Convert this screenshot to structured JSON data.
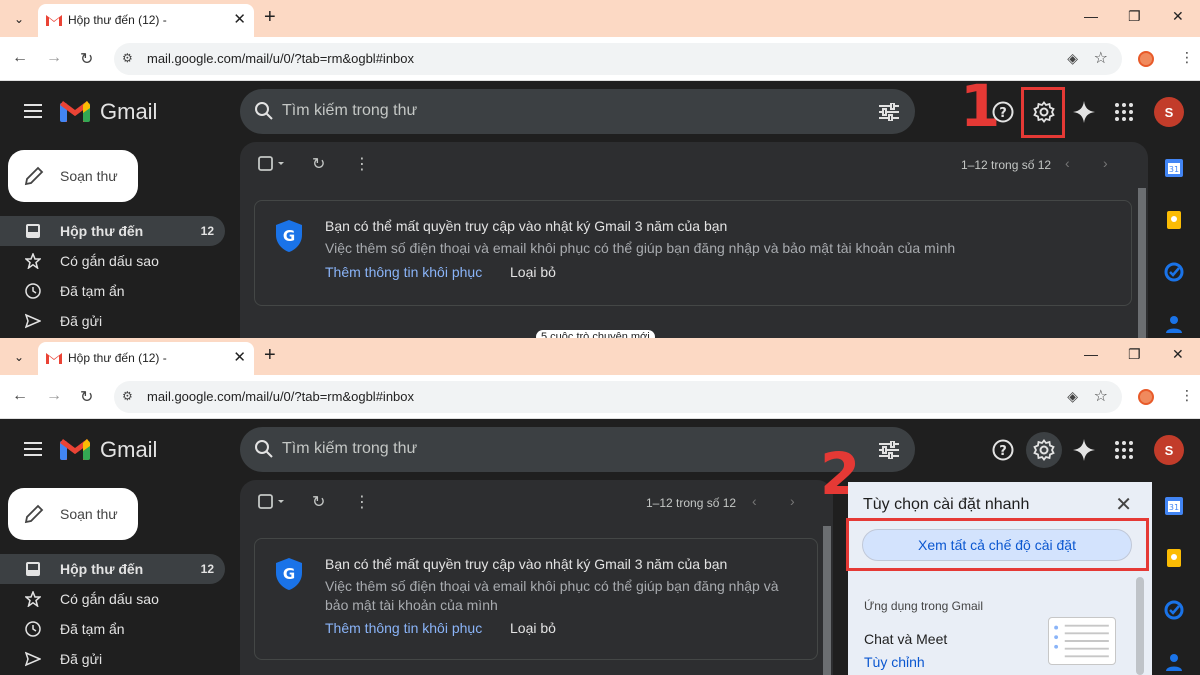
{
  "browser": {
    "tab_title": "Hộp thư đến (12) -",
    "url": "mail.google.com/mail/u/0/?tab=rm&ogbl#inbox"
  },
  "gmail": {
    "logo_text": "Gmail",
    "search_placeholder": "Tìm kiếm trong thư",
    "avatar_letter": "S",
    "compose_label": "Soạn thư",
    "nav": [
      {
        "label": "Hộp thư đến",
        "count": "12"
      },
      {
        "label": "Có gắn dấu sao",
        "count": ""
      },
      {
        "label": "Đã tạm ẩn",
        "count": ""
      },
      {
        "label": "Đã gửi",
        "count": ""
      }
    ],
    "pagination": "1–12 trong số 12",
    "notice": {
      "title": "Bạn có thể mất quyền truy cập vào nhật ký Gmail 3 năm của bạn",
      "body": "Việc thêm số điện thoại và email khôi phục có thể giúp bạn đăng nhập và bảo mật tài khoản của mình",
      "body_line1": "Việc thêm số điện thoại và email khôi phục có thể giúp bạn đăng nhập và",
      "body_line2": "bảo mật tài khoản của mình",
      "link": "Thêm thông tin khôi phục",
      "dismiss": "Loại bỏ"
    },
    "chat_snippet": "5 cuộc trò chuyện mới"
  },
  "steps": {
    "one": "1",
    "two": "2"
  },
  "quick_settings": {
    "title": "Tùy chọn cài đặt nhanh",
    "see_all": "Xem tất cả chế độ cài đặt",
    "section": "Ứng dụng trong Gmail",
    "chat_meet": "Chat và Meet",
    "customize": "Tùy chỉnh"
  },
  "colors": {
    "accent_red": "#e53935",
    "link_blue": "#8ab4f8",
    "dark_bg": "#1f1f1f",
    "chrome_tabbar": "#fcd9c4"
  }
}
